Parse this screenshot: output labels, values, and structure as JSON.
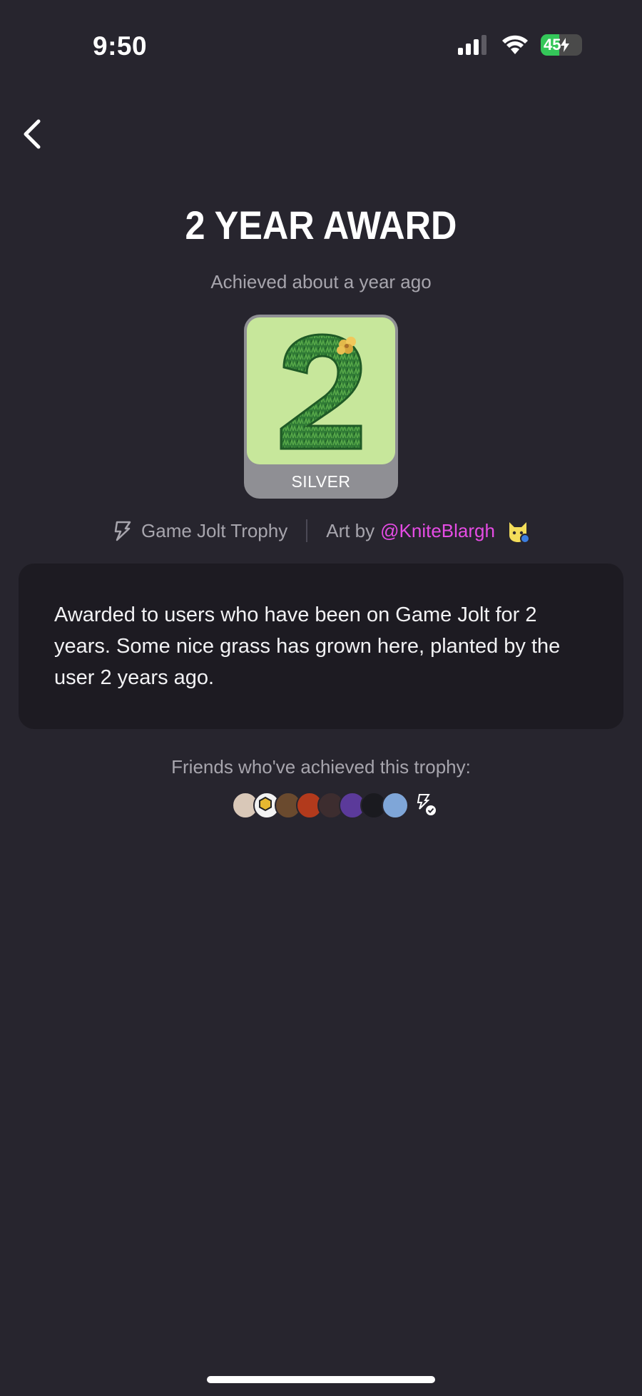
{
  "status_bar": {
    "time": "9:50",
    "battery_level": "45",
    "battery_percent": 45
  },
  "header": {
    "back_icon": "chevron-left-icon"
  },
  "trophy": {
    "title": "2 YEAR AWARD",
    "achieved_text": "Achieved about a year ago",
    "tier": "SILVER",
    "source": "Game Jolt Trophy",
    "art_by_label": "Art by",
    "artist": "@KniteBlargh",
    "description": "Awarded to users who have been on Game Jolt for 2 years. Some nice grass has grown here, planted by the user 2 years ago."
  },
  "friends": {
    "label": "Friends who've achieved this trophy:",
    "avatars": [
      "avatar-1",
      "avatar-2",
      "avatar-3",
      "avatar-4",
      "avatar-5",
      "avatar-6",
      "avatar-7",
      "avatar-8"
    ]
  },
  "colors": {
    "background": "#27252e",
    "card": "#1d1b22",
    "accent_link": "#e54ce4",
    "tier_silver": "#8f8f94",
    "trophy_bg": "#c7e79b",
    "battery": "#34c759"
  }
}
